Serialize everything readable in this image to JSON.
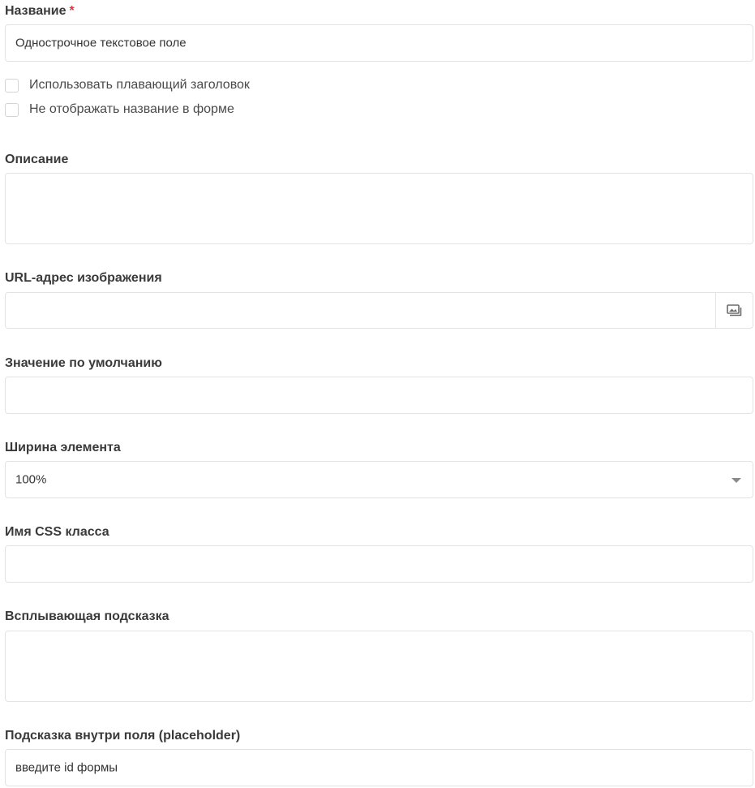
{
  "fields": {
    "name": {
      "label": "Название",
      "required_mark": "*",
      "value": "Однострочное текстовое поле"
    },
    "floating_label_checkbox": {
      "label": "Использовать плавающий заголовок",
      "checked": false
    },
    "hide_name_checkbox": {
      "label": "Не отображать название в форме",
      "checked": false
    },
    "description": {
      "label": "Описание",
      "value": ""
    },
    "image_url": {
      "label": "URL-адрес изображения",
      "value": "",
      "addon_icon": "image-gallery-icon"
    },
    "default_value": {
      "label": "Значение по умолчанию",
      "value": ""
    },
    "element_width": {
      "label": "Ширина элемента",
      "selected": "100%"
    },
    "css_class": {
      "label": "Имя CSS класса",
      "value": ""
    },
    "tooltip": {
      "label": "Всплывающая подсказка",
      "value": ""
    },
    "placeholder": {
      "label": "Подсказка внутри поля (placeholder)",
      "value": "введите id формы"
    }
  },
  "colors": {
    "required": "#e5323e",
    "border": "#e3e3e3",
    "label": "#3a3a3a",
    "text": "#333333"
  }
}
